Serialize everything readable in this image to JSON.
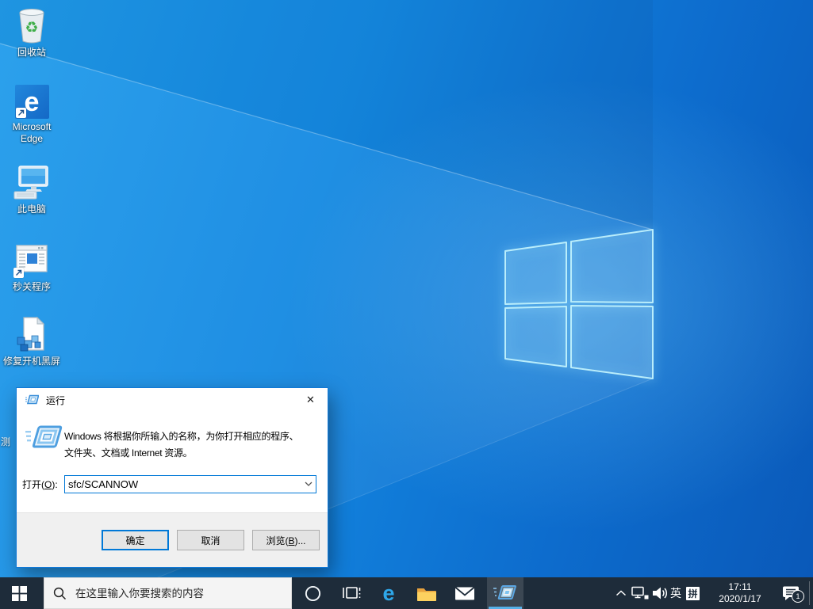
{
  "desktop": {
    "icons": [
      {
        "name": "recycle-bin",
        "label": "回收站"
      },
      {
        "name": "microsoft-edge",
        "label": "Microsoft Edge"
      },
      {
        "name": "this-pc",
        "label": "此电脑"
      },
      {
        "name": "seconds-close-app",
        "label": "秒关程序"
      },
      {
        "name": "fix-boot-black-screen",
        "label": "修复开机黑屏"
      }
    ],
    "partial_icon_label": "测"
  },
  "run_dialog": {
    "title": "运行",
    "close_glyph": "✕",
    "description_line1": "Windows 将根据你所输入的名称，为你打开相应的程序、",
    "description_line2": "文件夹、文档或 Internet 资源。",
    "open_label": {
      "pre": "打开(",
      "key": "O",
      "post": "):"
    },
    "input_value": "sfc/SCANNOW",
    "buttons": {
      "ok": "确定",
      "cancel": "取消",
      "browse": {
        "pre": "浏览(",
        "key": "B",
        "post": ")..."
      }
    }
  },
  "taskbar": {
    "search_placeholder": "在这里输入你要搜索的内容",
    "edge_glyph": "e",
    "tray": {
      "ime_lang": "英",
      "ime_mode": "拼",
      "time": "17:11",
      "date": "2020/1/17",
      "notification_count": "1"
    }
  },
  "colors": {
    "taskbar_bg": "#1e2c3a",
    "accent_blue": "#0078d7",
    "active_underline": "#57b1e8",
    "wallpaper_light": "#219ceb",
    "wallpaper_deep": "#0a58b8",
    "logo_stroke": "#b9edfb"
  }
}
